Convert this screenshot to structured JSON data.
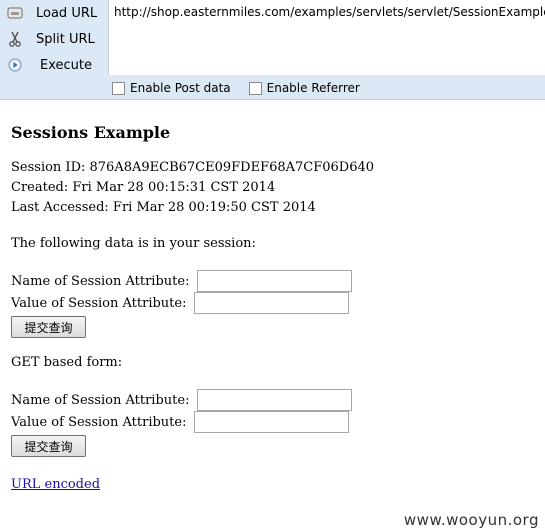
{
  "hackbar": {
    "buttons": [
      {
        "label": "Load URL",
        "icon": "load-url-icon"
      },
      {
        "label": "Split URL",
        "icon": "scissors-icon"
      },
      {
        "label": "Execute",
        "icon": "execute-icon"
      }
    ],
    "url": "http://shop.easternmiles.com/examples/servlets/servlet/SessionExample",
    "options": [
      {
        "label": "Enable Post data",
        "checked": false
      },
      {
        "label": "Enable Referrer",
        "checked": false
      }
    ]
  },
  "page": {
    "title": "Sessions Example",
    "session_id": "Session ID: 876A8A9ECB67CE09FDEF68A7CF06D640",
    "created": "Created: Fri Mar 28 00:15:31 CST 2014",
    "last_accessed": "Last Accessed: Fri Mar 28 00:19:50 CST 2014",
    "data_intro": "The following data is in your session:",
    "form1": {
      "name_label": "Name of Session Attribute:",
      "value_label": "Value of Session Attribute:",
      "name_value": "",
      "value_value": "",
      "submit_label": "提交查询"
    },
    "get_form_label": "GET based form:",
    "form2": {
      "name_label": "Name of Session Attribute:",
      "value_label": "Value of Session Attribute:",
      "name_value": "",
      "value_value": "",
      "submit_label": "提交查询"
    },
    "url_encoded_link": "URL encoded"
  },
  "watermark": "www.wooyun.org",
  "colors": {
    "toolbar_bg": "#dbe8f5",
    "link": "#1a0dab"
  }
}
